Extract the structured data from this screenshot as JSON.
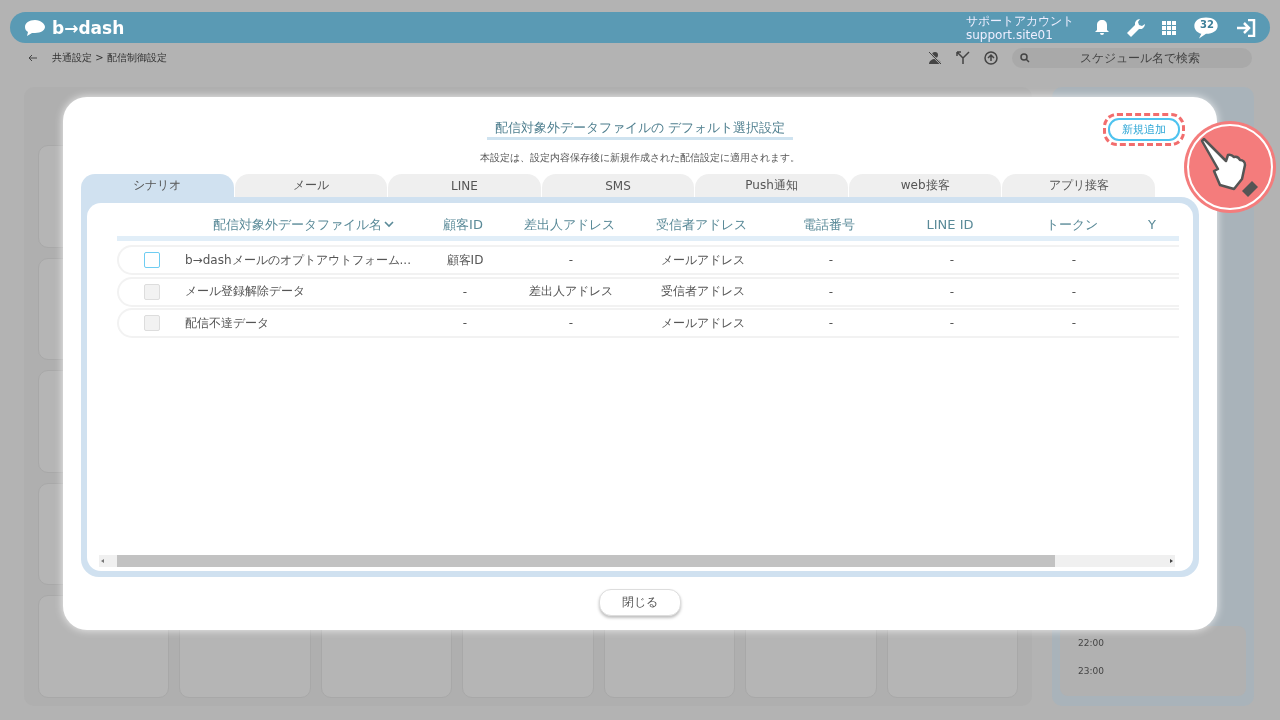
{
  "header": {
    "logo": "b→dash",
    "account_label": "サポートアカウント",
    "account_id": "support.site01",
    "chat_count": "32"
  },
  "breadcrumb": {
    "items": [
      "共通設定",
      "配信制御設定"
    ],
    "separator": ">"
  },
  "search": {
    "placeholder": "スケジュール名で検索"
  },
  "schedule_panel": {
    "times": [
      "22:00",
      "23:00"
    ]
  },
  "dialog": {
    "title": "配信対象外データファイルの デフォルト選択設定",
    "note": "本設定は、設定内容保存後に新規作成された配信設定に適用されます。",
    "add_button": {
      "label": "新規追加",
      "highlighted": true
    },
    "tabs": [
      {
        "label": "シナリオ",
        "selected": true
      },
      {
        "label": "メール",
        "selected": false
      },
      {
        "label": "LINE",
        "selected": false
      },
      {
        "label": "SMS",
        "selected": false
      },
      {
        "label": "Push通知",
        "selected": false
      },
      {
        "label": "web接客",
        "selected": false
      },
      {
        "label": "アプリ接客",
        "selected": false
      }
    ],
    "table": {
      "columns": [
        {
          "label": "配信対象外データファイル名",
          "sorted": true
        },
        {
          "label": "顧客ID",
          "sorted": false
        },
        {
          "label": "差出人アドレス",
          "sorted": false
        },
        {
          "label": "受信者アドレス",
          "sorted": false
        },
        {
          "label": "電話番号",
          "sorted": false
        },
        {
          "label": "LINE ID",
          "sorted": false
        },
        {
          "label": "トークン",
          "sorted": false
        },
        {
          "label": "Y",
          "sorted": false
        }
      ],
      "rows": [
        {
          "checked": false,
          "disabled": false,
          "cells": [
            "b→dashメールのオプトアウトフォーム...",
            "顧客ID",
            "-",
            "メールアドレス",
            "-",
            "-",
            "-"
          ]
        },
        {
          "checked": false,
          "disabled": true,
          "cells": [
            "メール登録解除データ",
            "-",
            "差出人アドレス",
            "受信者アドレス",
            "-",
            "-",
            "-"
          ]
        },
        {
          "checked": false,
          "disabled": true,
          "cells": [
            "配信不達データ",
            "-",
            "-",
            "メールアドレス",
            "-",
            "-",
            "-"
          ]
        }
      ]
    },
    "close_button": "閉じる"
  }
}
